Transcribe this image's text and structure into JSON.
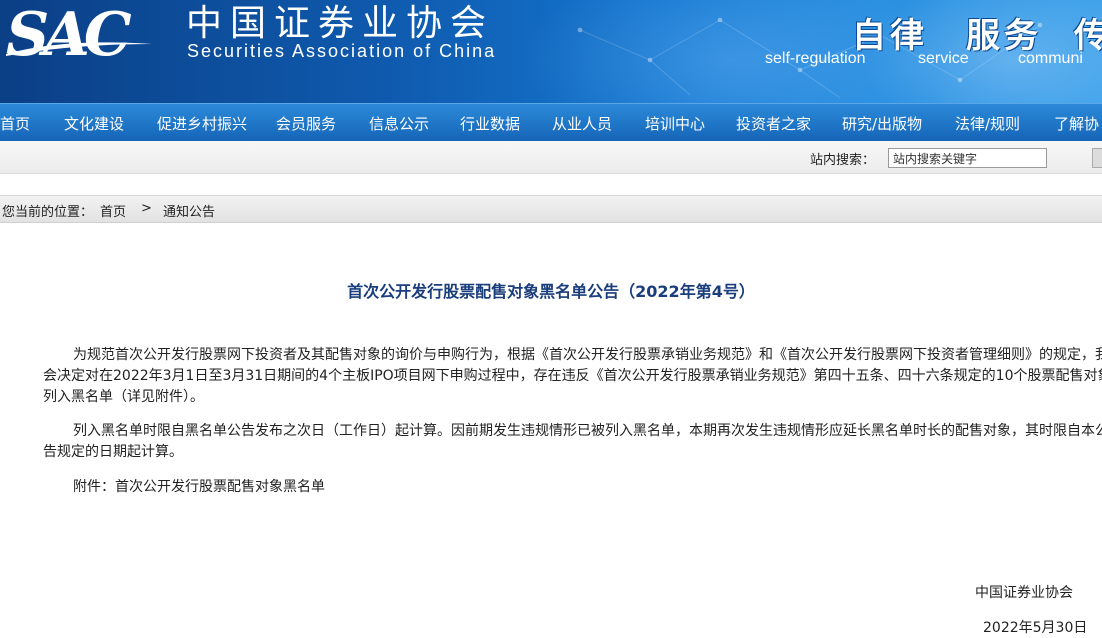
{
  "header": {
    "logo_text": "SAC",
    "org_name_cn": "中国证券业协会",
    "org_name_en": "Securities Association of China",
    "slogans_cn": [
      "自律",
      "服务",
      "传"
    ],
    "slogans_en": [
      "self-regulation",
      "service",
      "communi"
    ]
  },
  "nav": {
    "items": [
      "首页",
      "文化建设",
      "促进乡村振兴",
      "会员服务",
      "信息公示",
      "行业数据",
      "从业人员",
      "培训中心",
      "投资者之家",
      "研究/出版物",
      "法律/规则",
      "了解协"
    ]
  },
  "search": {
    "label": "站内搜索：",
    "placeholder": "站内搜索关键字"
  },
  "breadcrumb": {
    "prefix": "您当前的位置：",
    "home": "首页",
    "separator": ">",
    "current": "通知公告"
  },
  "article": {
    "title": "首次公开发行股票配售对象黑名单公告（2022年第4号）",
    "paragraphs": [
      "为规范首次公开发行股票网下投资者及其配售对象的询价与申购行为，根据《首次公开发行股票承销业务规范》和《首次公开发行股票网下投资者管理细则》的规定，我会决定对在2022年3月1日至3月31日期间的4个主板IPO项目网下申购过程中，存在违反《首次公开发行股票承销业务规范》第四十五条、四十六条规定的10个股票配售对象列入黑名单（详见附件）。",
      "列入黑名单时限自黑名单公告发布之次日（工作日）起计算。因前期发生违规情形已被列入黑名单，本期再次发生违规情形应延长黑名单时长的配售对象，其时限自本公告规定的日期起计算。",
      "附件：首次公开发行股票配售对象黑名单"
    ],
    "signature_org": "中国证券业协会",
    "signature_date": "2022年5月30日"
  },
  "colors": {
    "banner_dark": "#0b3f86",
    "nav_blue": "#1565b8",
    "title_blue": "#1a3d7c"
  }
}
